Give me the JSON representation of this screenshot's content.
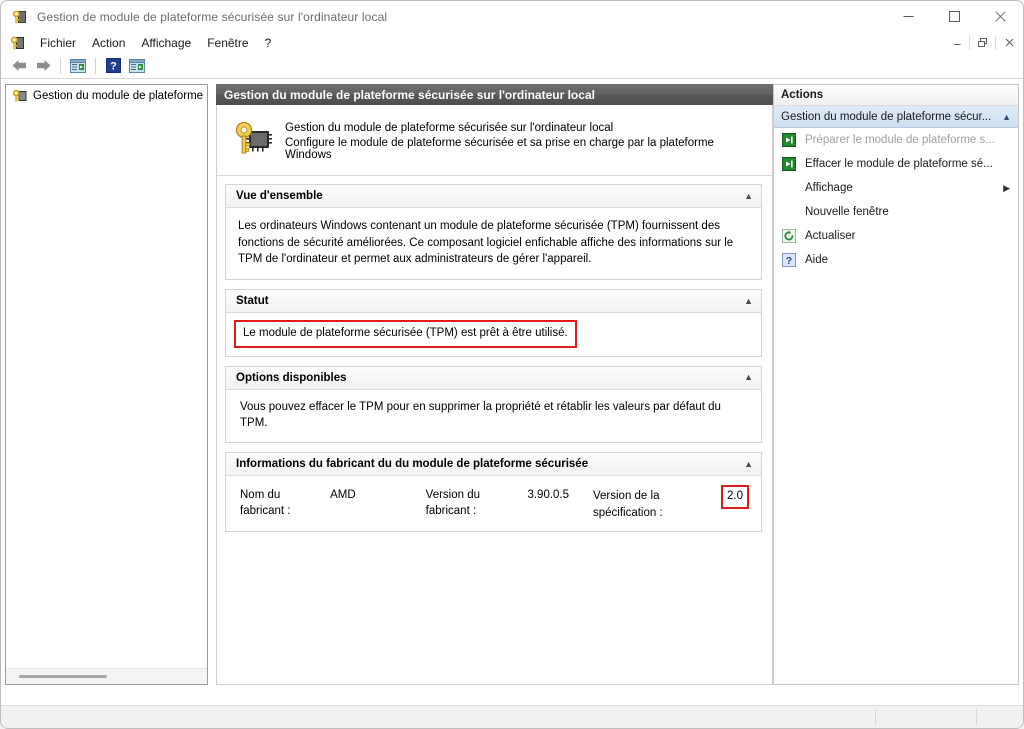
{
  "window": {
    "title": "Gestion de module de plateforme sécurisée sur l'ordinateur local",
    "icon": "tpm-key-chip-icon",
    "minimize_label": "Réduire",
    "maximize_label": "Agrandir",
    "close_label": "Fermer"
  },
  "menubar": {
    "icon": "tpm-key-chip-icon",
    "items": [
      {
        "label": "Fichier"
      },
      {
        "label": "Action"
      },
      {
        "label": "Affichage"
      },
      {
        "label": "Fenêtre"
      },
      {
        "label": "?"
      }
    ],
    "mdi": {
      "minimize_label": "_",
      "restore_label": "❐",
      "close_label": "✕"
    }
  },
  "toolbar": {
    "buttons": [
      {
        "name": "back-arrow-icon",
        "glyph": "←"
      },
      {
        "name": "forward-arrow-icon",
        "glyph": "→"
      },
      {
        "name": "show-hide-tree-icon",
        "glyph": "▤"
      },
      {
        "name": "help-icon",
        "glyph": "?"
      },
      {
        "name": "show-hide-action-pane-icon",
        "glyph": "▤"
      }
    ]
  },
  "tree": {
    "nodes": [
      {
        "label": "Gestion du module de plateforme :",
        "icon": "tpm-key-chip-icon"
      }
    ]
  },
  "content": {
    "header_title": "Gestion du module de plateforme sécurisée sur l'ordinateur local",
    "intro": {
      "icon": "tpm-key-chip-large-icon",
      "line1": "Gestion du module de plateforme sécurisée sur l'ordinateur local",
      "line2": "Configure le module de plateforme sécurisée et sa prise en charge par la plateforme Windows"
    },
    "sections": [
      {
        "id": "overview",
        "title": "Vue d'ensemble",
        "collapse_glyph": "▲",
        "body": "Les ordinateurs Windows contenant un module de plateforme sécurisée (TPM) fournissent des fonctions de sécurité améliorées. Ce composant logiciel enfichable affiche des informations sur le TPM de l'ordinateur et permet aux administrateurs de gérer l'appareil."
      },
      {
        "id": "status",
        "title": "Statut",
        "collapse_glyph": "▲",
        "body": "Le module de plateforme sécurisée (TPM) est prêt à être utilisé.",
        "highlighted": true
      },
      {
        "id": "available-options",
        "title": "Options disponibles",
        "collapse_glyph": "▲",
        "body": "Vous pouvez effacer le TPM pour en supprimer la propriété et rétablir les valeurs par défaut du TPM."
      },
      {
        "id": "manufacturer-info",
        "title": "Informations du fabricant du du module de plateforme sécurisée",
        "collapse_glyph": "▲",
        "fields": [
          {
            "label": "Nom du fabricant :",
            "value": "AMD"
          },
          {
            "label": "Version du fabricant :",
            "value": "3.90.0.5"
          },
          {
            "label": "Version de la spécification :",
            "value": "2.0",
            "highlighted": true
          }
        ]
      }
    ]
  },
  "actions": {
    "header": "Actions",
    "group": {
      "label": "Gestion du module de plateforme sécur...",
      "collapse_glyph": "▲"
    },
    "items": [
      {
        "label": "Préparer le module de plateforme s...",
        "icon": "green-arrow-icon",
        "disabled": true,
        "submenu": false
      },
      {
        "label": "Effacer le module de plateforme sé...",
        "icon": "green-arrow-icon",
        "disabled": false,
        "submenu": false
      },
      {
        "label": "Affichage",
        "icon": "none",
        "disabled": false,
        "submenu": true,
        "submenu_glyph": "▶"
      },
      {
        "label": "Nouvelle fenêtre",
        "icon": "none",
        "disabled": false,
        "submenu": false
      },
      {
        "label": "Actualiser",
        "icon": "refresh-icon",
        "disabled": false,
        "submenu": false
      },
      {
        "label": "Aide",
        "icon": "help-icon",
        "disabled": false,
        "submenu": false
      }
    ]
  },
  "statusbar": {
    "segments": [
      "",
      "",
      ""
    ]
  },
  "colors": {
    "accent_red": "#e01b1b",
    "content_header_gray": "#5c5c5c",
    "actions_group_blue": "#cfe0f2",
    "green_arrow": "#1e8a2e"
  }
}
